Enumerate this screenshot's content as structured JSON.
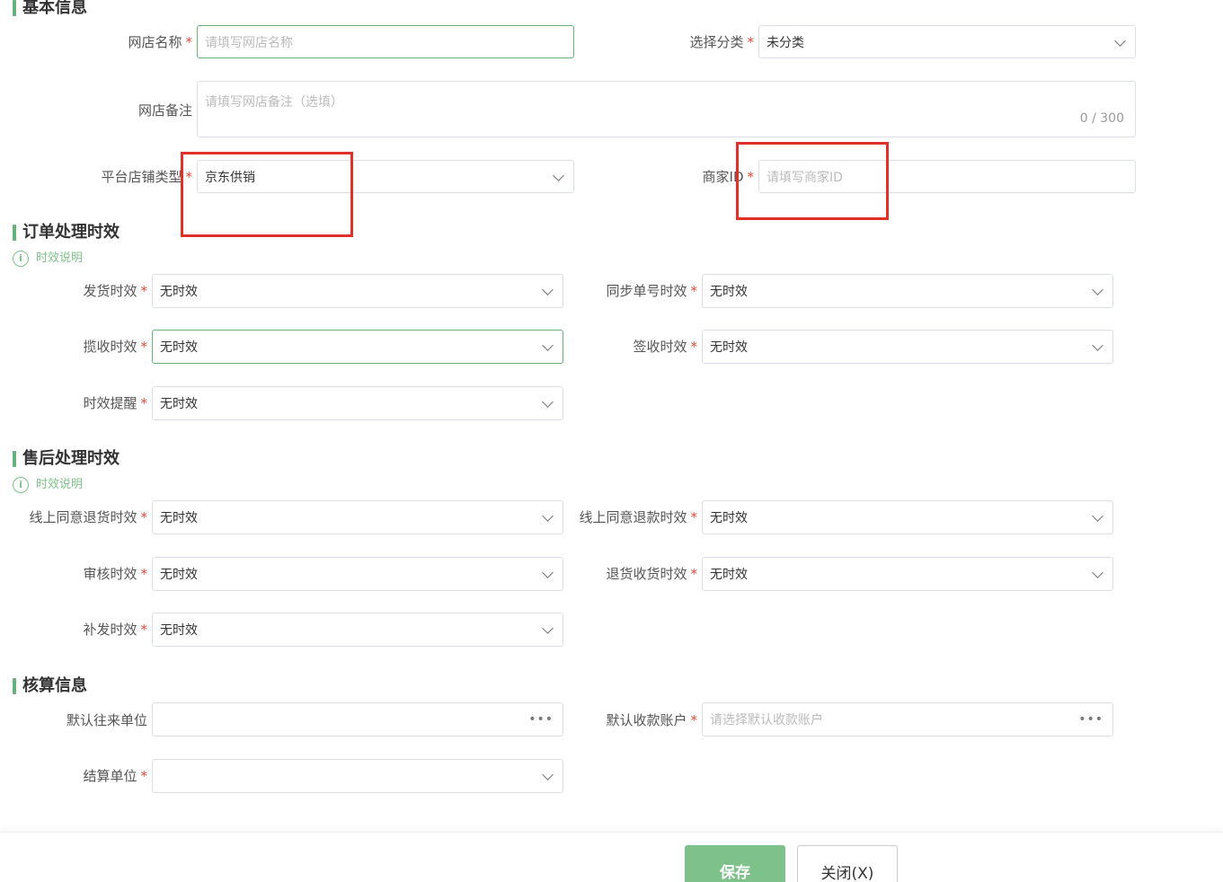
{
  "sections": {
    "basic": "基本信息",
    "order": "订单处理时效",
    "aftersale": "售后处理时效",
    "accounting": "核算信息"
  },
  "help_text": "时效说明",
  "required_mark": "*",
  "basic": {
    "shop_name": {
      "label": "网店名称",
      "placeholder": "请填写网店名称"
    },
    "category": {
      "label": "选择分类",
      "value": "未分类"
    },
    "remark": {
      "label": "网店备注",
      "placeholder": "请填写网店备注（选填）",
      "count": "0 / 300"
    },
    "platform_type": {
      "label": "平台店铺类型",
      "value": "京东供销"
    },
    "merchant_id": {
      "label": "商家ID",
      "placeholder": "请填写商家ID"
    }
  },
  "order": {
    "ship": {
      "label": "发货时效",
      "value": "无时效"
    },
    "sync_no": {
      "label": "同步单号时效",
      "value": "无时效"
    },
    "pickup": {
      "label": "揽收时效",
      "value": "无时效"
    },
    "sign": {
      "label": "签收时效",
      "value": "无时效"
    },
    "remind": {
      "label": "时效提醒",
      "value": "无时效"
    }
  },
  "aftersale": {
    "agree_return": {
      "label": "线上同意退货时效",
      "value": "无时效"
    },
    "agree_refund": {
      "label": "线上同意退款时效",
      "value": "无时效"
    },
    "audit": {
      "label": "审核时效",
      "value": "无时效"
    },
    "return_receive": {
      "label": "退货收货时效",
      "value": "无时效"
    },
    "reissue": {
      "label": "补发时效",
      "value": "无时效"
    }
  },
  "accounting": {
    "default_partner": {
      "label": "默认往来单位",
      "value": ""
    },
    "default_account": {
      "label": "默认收款账户",
      "placeholder": "请选择默认收款账户"
    },
    "settle_unit": {
      "label": "结算单位",
      "value": ""
    }
  },
  "footer": {
    "save": "保存",
    "close": "关闭(X)"
  },
  "colors": {
    "accent": "#67b27a",
    "required": "#e04a3a",
    "highlight_box": "#e0302a"
  },
  "icons": {
    "dropdown": "chevron-down-icon",
    "more": "more-dots-icon",
    "info": "info-circle-icon"
  }
}
